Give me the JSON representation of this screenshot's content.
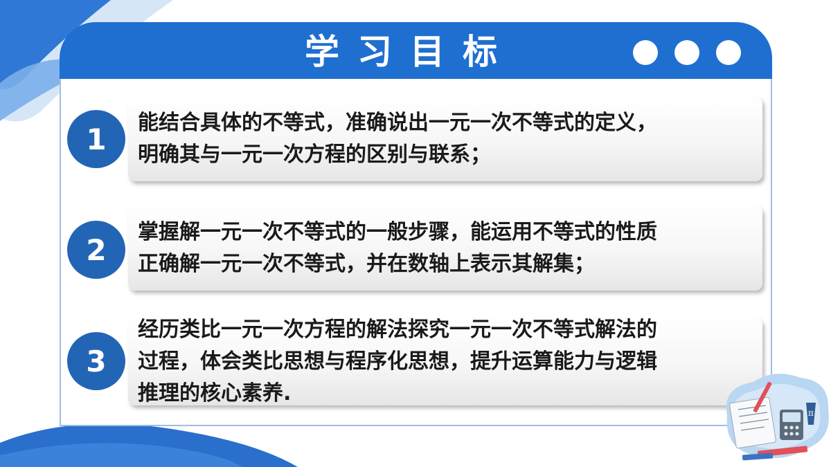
{
  "slide": {
    "title": "学习目标",
    "goals": [
      {
        "number": "1",
        "text": "能结合具体的不等式，准确说出一元一次不等式的定义，\n明确其与一元一次方程的区别与联系；"
      },
      {
        "number": "2",
        "text": "掌握解一元一次不等式的一般步骤，能运用不等式的性质\n正确解一元一次不等式，并在数轴上表示其解集；"
      },
      {
        "number": "3",
        "text": "经历类比一元一次方程的解法探究一元一次不等式解法的\n过程，体会类比思想与程序化思想，提升运算能力与逻辑\n推理的核心素养."
      }
    ]
  },
  "colors": {
    "header_blue": "#1e6fd0",
    "badge_blue": "#2365b5",
    "frame_border": "#9bbfe6"
  },
  "icons": {
    "decor_dots": "three-white-circles",
    "illustration": "math-study-clipart"
  }
}
